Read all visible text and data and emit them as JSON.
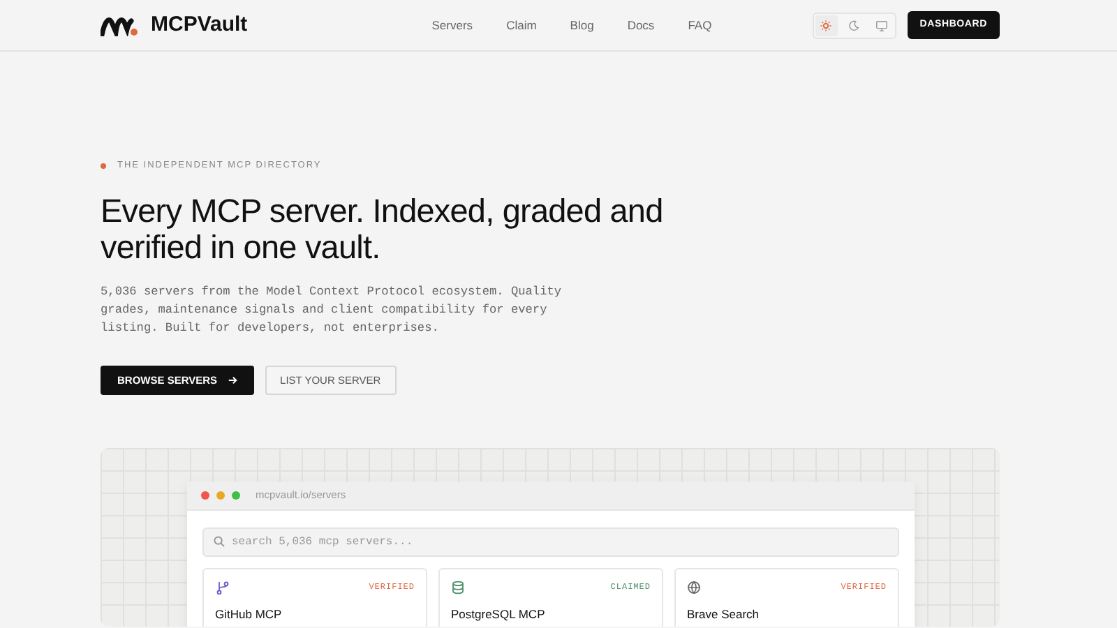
{
  "brand": {
    "name": "MCPVault"
  },
  "nav": [
    {
      "label": "Servers"
    },
    {
      "label": "Claim"
    },
    {
      "label": "Blog"
    },
    {
      "label": "Docs"
    },
    {
      "label": "FAQ"
    }
  ],
  "theme_toggle": [
    {
      "kind": "light",
      "selected": true
    },
    {
      "kind": "dark",
      "selected": false
    },
    {
      "kind": "system",
      "selected": false
    }
  ],
  "dashboard_button": "DASHBOARD",
  "hero": {
    "eyebrow": "THE INDEPENDENT MCP DIRECTORY",
    "title": "Every MCP server. Indexed, graded and verified in one vault.",
    "description": "5,036 servers from the Model Context Protocol ecosystem. Quality grades, maintenance signals and client compatibility for every listing. Built for developers, not enterprises.",
    "primary_button": "BROWSE SERVERS",
    "secondary_button": "LIST YOUR SERVER"
  },
  "preview": {
    "url": "mcpvault.io/servers",
    "search": {
      "placeholder": "search 5,036 mcp servers..."
    },
    "cards": [
      {
        "kind": "branch",
        "name": "GitHub MCP",
        "badge": "VERIFIED",
        "color": "#e0673f"
      },
      {
        "kind": "database",
        "name": "PostgreSQL MCP",
        "badge": "CLAIMED",
        "color": "#4f8f6a"
      },
      {
        "kind": "globe",
        "name": "Brave Search",
        "badge": "VERIFIED",
        "color": "#e0673f"
      }
    ]
  }
}
